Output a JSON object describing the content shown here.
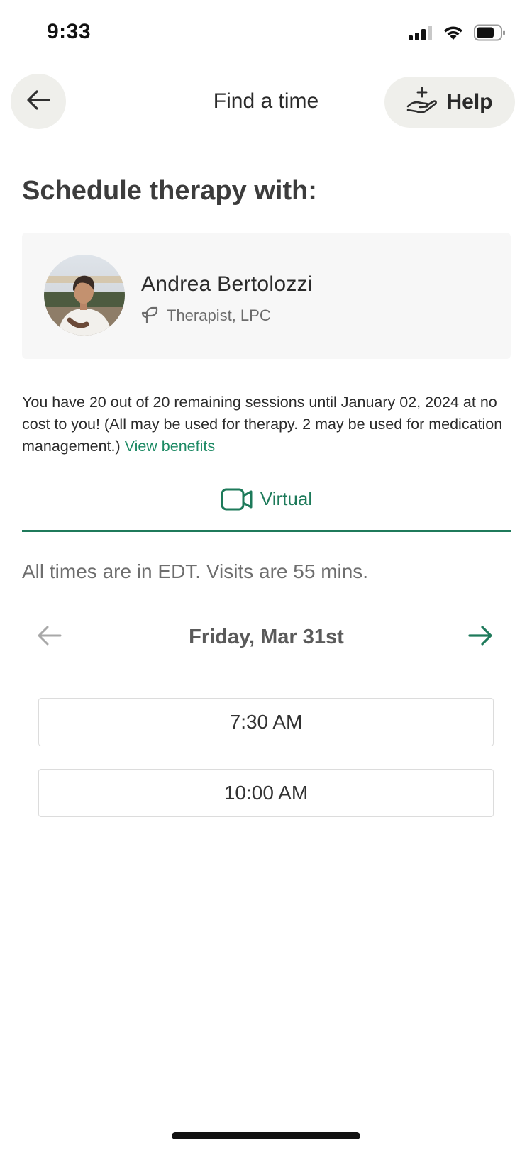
{
  "status_bar": {
    "time": "9:33",
    "icons": [
      "cellular-signal-icon",
      "wifi-icon",
      "battery-icon"
    ]
  },
  "header": {
    "back_icon": "arrow-left-icon",
    "title": "Find a time",
    "help_icon": "hand-with-plus-icon",
    "help_label": "Help"
  },
  "section_title": "Schedule therapy with:",
  "provider": {
    "name": "Andrea Bertolozzi",
    "role": "Therapist, LPC",
    "role_icon": "sprout-icon"
  },
  "benefits": {
    "text": "You have 20 out of 20 remaining sessions until January 02, 2024 at no cost to you! (All may be used for therapy. 2 may be used for medication management.)",
    "link_label": "View benefits"
  },
  "visit_type": {
    "label": "Virtual",
    "icon": "video-camera-icon"
  },
  "timezone_note": "All times are in EDT. Visits are 55 mins.",
  "date_nav": {
    "date": "Friday, Mar 31st",
    "prev_icon": "arrow-left-icon",
    "next_icon": "arrow-right-icon"
  },
  "slots": [
    "7:30 AM",
    "10:00 AM"
  ],
  "colors": {
    "accent": "#1d8a64",
    "button_bg": "#efefeb",
    "card_bg": "#f7f7f7"
  }
}
